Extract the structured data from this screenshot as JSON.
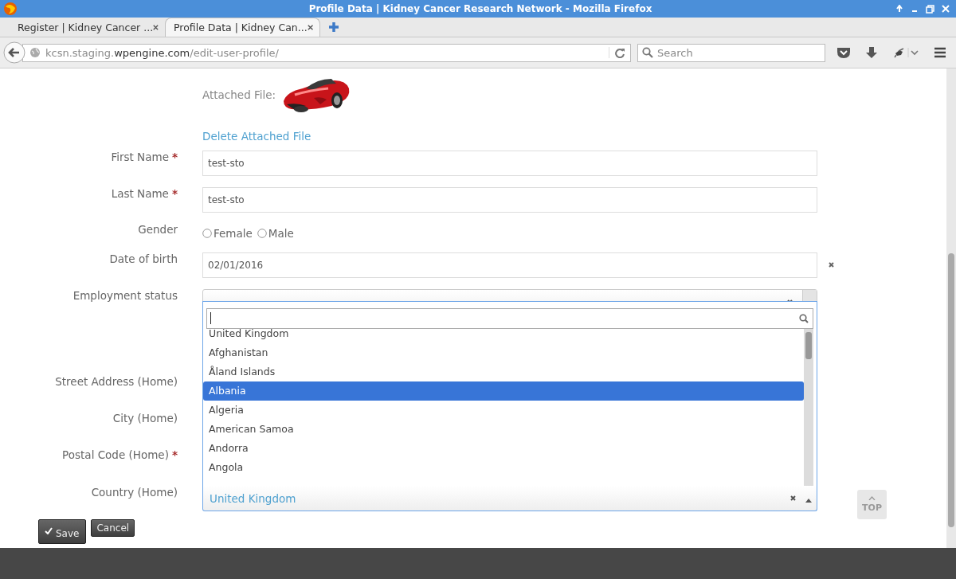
{
  "window": {
    "title": "Profile Data | Kidney Cancer Research Network - Mozilla Firefox"
  },
  "tabs": [
    {
      "label": "Register | Kidney Cancer ...",
      "selected": false
    },
    {
      "label": "Profile Data | Kidney Can...",
      "selected": true
    }
  ],
  "address_bar": {
    "host_prefix": "kcsn.staging.",
    "domain": "wpengine.com",
    "path": "/edit-user-profile/"
  },
  "search": {
    "placeholder": "Search"
  },
  "form": {
    "attachment": {
      "label": "Attached File:",
      "kind": "picture",
      "delete_link": "Delete Attached File"
    },
    "fields": [
      {
        "kind": "text",
        "label": "First Name",
        "required_mark": "*",
        "value": "test-sto"
      },
      {
        "kind": "text",
        "label": "Last Name",
        "required_mark": "*",
        "value": "test-sto"
      },
      {
        "kind": "radio",
        "label": "Gender",
        "options": [
          {
            "label": "Female",
            "selected": false
          },
          {
            "label": "Male",
            "selected": false
          }
        ]
      },
      {
        "kind": "date",
        "label": "Date of birth",
        "value": "02/01/2016"
      },
      {
        "kind": "select",
        "label": "Employment status",
        "open": false
      },
      {
        "kind": "covered",
        "label": "Street Address (Home)"
      },
      {
        "kind": "covered",
        "label": "City (Home)"
      },
      {
        "kind": "covered",
        "label": "Postal Code (Home)",
        "required_mark": "*"
      },
      {
        "kind": "select",
        "label": "Country (Home)",
        "value": "United Kingdom",
        "open": true,
        "dropdown": {
          "options": [
            {
              "label": "United Kingdom",
              "selected": false
            },
            {
              "label": "Afghanistan",
              "selected": false
            },
            {
              "label": "Åland Islands",
              "selected": false
            },
            {
              "label": "Albania",
              "selected": true
            },
            {
              "label": "Algeria",
              "selected": false
            },
            {
              "label": "American Samoa",
              "selected": false
            },
            {
              "label": "Andorra",
              "selected": false
            },
            {
              "label": "Angola",
              "selected": false
            }
          ]
        }
      }
    ],
    "buttons": [
      {
        "kind": "save",
        "label": "Save"
      },
      {
        "kind": "cancel",
        "label": "Cancel"
      }
    ]
  },
  "top_button": {
    "label": "TOP"
  }
}
